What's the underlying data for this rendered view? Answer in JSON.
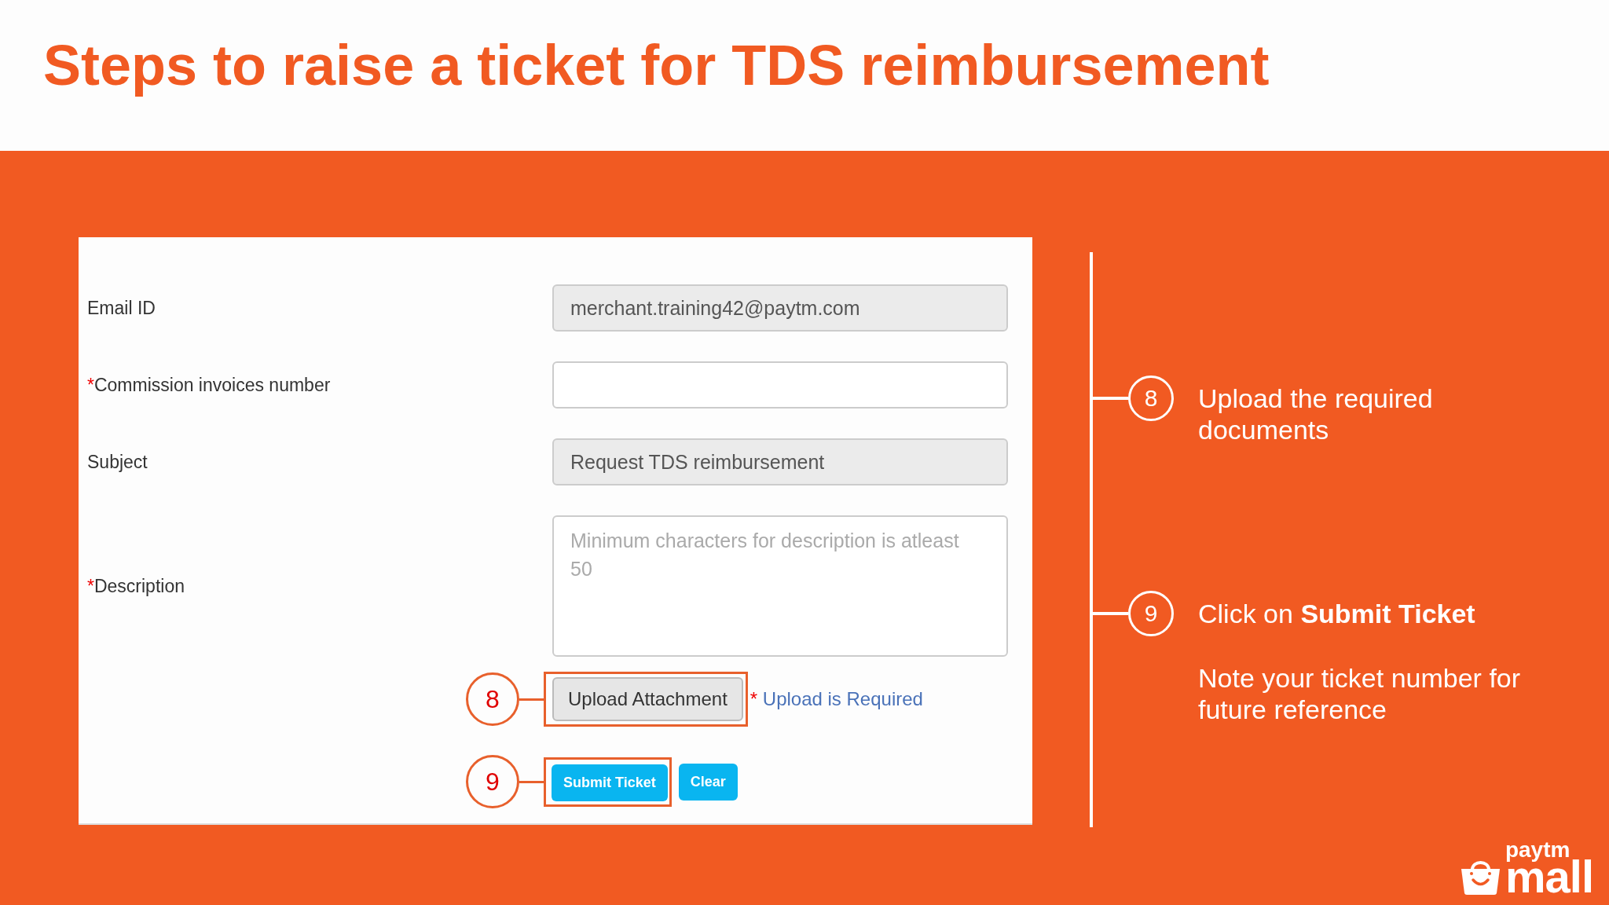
{
  "title": "Steps to raise a ticket for TDS reimbursement",
  "form": {
    "fields": [
      {
        "label": "Email ID",
        "kind": "input",
        "value": "merchant.training42@paytm.com",
        "disabled": true
      },
      {
        "label": "Commission invoices number",
        "required_mark": "*",
        "kind": "input",
        "disabled": false
      },
      {
        "label": "Subject",
        "kind": "input",
        "value": "Request TDS reimbursement",
        "disabled": true
      },
      {
        "label": "Description",
        "required_mark": "*",
        "kind": "textarea",
        "placeholder": "Minimum characters for description is atleast 50",
        "disabled": false
      }
    ],
    "upload": {
      "step": "8",
      "button": {
        "label": "Upload Attachment",
        "highlighted": true
      },
      "required_mark": "*",
      "note": "Upload is Required"
    },
    "actions": {
      "step": "9",
      "buttons": [
        {
          "label": "Submit Ticket",
          "highlighted": true
        },
        {
          "label": "Clear",
          "highlighted": false
        }
      ]
    }
  },
  "steps": [
    {
      "number": "8",
      "text": "Upload the required documents"
    },
    {
      "number": "9",
      "text": "Click on **Submit Ticket**",
      "note": "Note your ticket number for future reference"
    }
  ],
  "logo": {
    "top": "paytm",
    "bottom": "mall"
  }
}
